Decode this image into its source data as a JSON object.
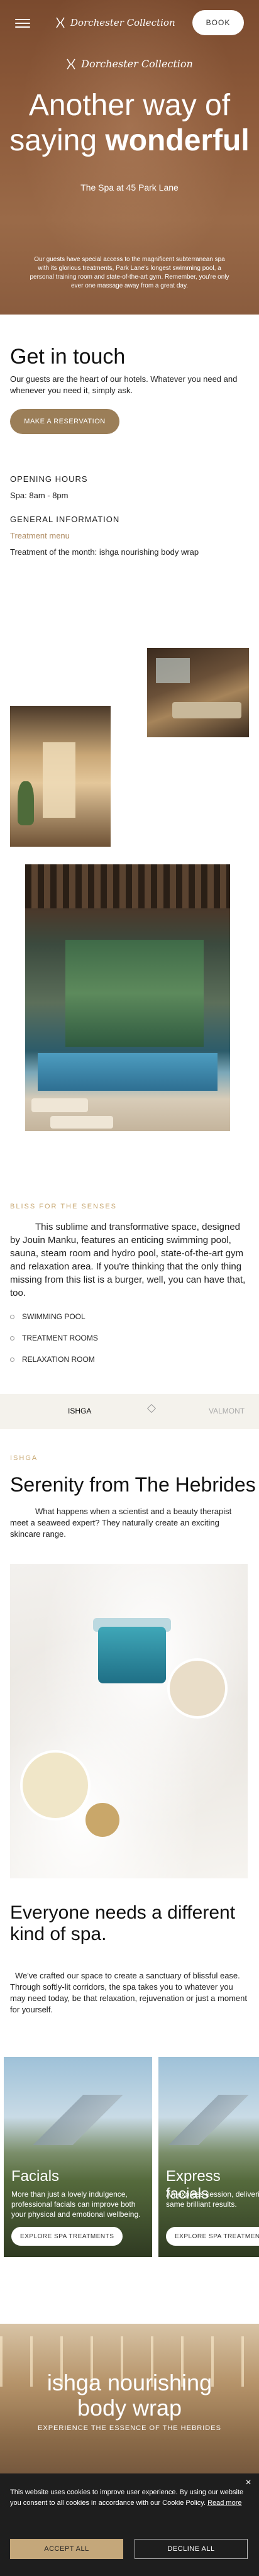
{
  "header": {
    "brand": "Dorchester Collection",
    "book_label": "BOOK"
  },
  "hero": {
    "brand": "Dorchester Collection",
    "title_line1": "Another way of",
    "title_line2_light": "saying ",
    "title_line2_bold": "wonderful",
    "subtitle": "The Spa at 45 Park Lane",
    "paragraph": "Our guests have special access to the magnificent subterranean spa with its glorious treatments, Park Lane's longest swimming pool, a personal training room and state-of-the-art gym. Remember, you're only ever one massage away from a great day."
  },
  "contact": {
    "title": "Get in touch",
    "text": "Our guests are the heart of our hotels. Whatever you need and whenever you need it, simply ask.",
    "reserve_label": "MAKE A RESERVATION",
    "opening_hours_label": "OPENING HOURS",
    "opening_hours_value": "Spa: 8am - 8pm",
    "general_info_label": "GENERAL INFORMATION",
    "treatment_menu_label": "Treatment menu",
    "treatment_month": "Treatment of the month: ishga nourishing body wrap"
  },
  "bliss": {
    "kicker": "BLISS FOR THE SENSES",
    "paragraph": "This sublime and transformative space, designed by Jouin Manku, features an enticing swimming pool, sauna, steam room and hydro pool, state-of-the-art gym and relaxation area. If you're thinking that the only thing missing from this list is a burger, well, you can have that, too.",
    "amenities": [
      "SWIMMING POOL",
      "TREATMENT ROOMS",
      "RELAXATION ROOM"
    ]
  },
  "tabs": {
    "ishga": "ISHGA",
    "valmont": "VALMONT"
  },
  "ishga": {
    "kicker": "ISHGA",
    "title": "Serenity from The Hebrides",
    "paragraph": "What happens when a scientist and a beauty therapist meet a seaweed expert? They naturally create an exciting skincare range."
  },
  "everyone": {
    "title": "Everyone needs a different kind of spa.",
    "paragraph": "We've crafted our space to create a sanctuary of blissful ease. Through softly-lit corridors, the spa takes you to whatever you may need today, be that relaxation, rejuvenation or just a moment for yourself."
  },
  "cards": [
    {
      "title": "Facials",
      "text": "More than just a lovely indulgence, professional facials can improve both your physical and emotional wellbeing.",
      "button": "EXPLORE SPA TREATMENTS"
    },
    {
      "title": "Express facials",
      "text": "An express session, delivering the same brilliant results.",
      "button": "EXPLORE SPA TREATMENTS"
    }
  ],
  "wrap": {
    "title_line1": "ishga nourishing",
    "title_line2": "body wrap",
    "subtitle": "EXPERIENCE THE ESSENCE OF THE HEBRIDES"
  },
  "cookies": {
    "close": "×",
    "text": "This website uses cookies to improve user experience. By using our website you consent to all cookies in accordance with our Cookie Policy.",
    "read_more": "Read more",
    "accept": "ACCEPT ALL",
    "decline": "DECLINE ALL"
  },
  "colors": {
    "accent_gold": "#9b7e58",
    "kicker_gold": "#c8a873",
    "hero_brown": "#8d5a3a"
  }
}
